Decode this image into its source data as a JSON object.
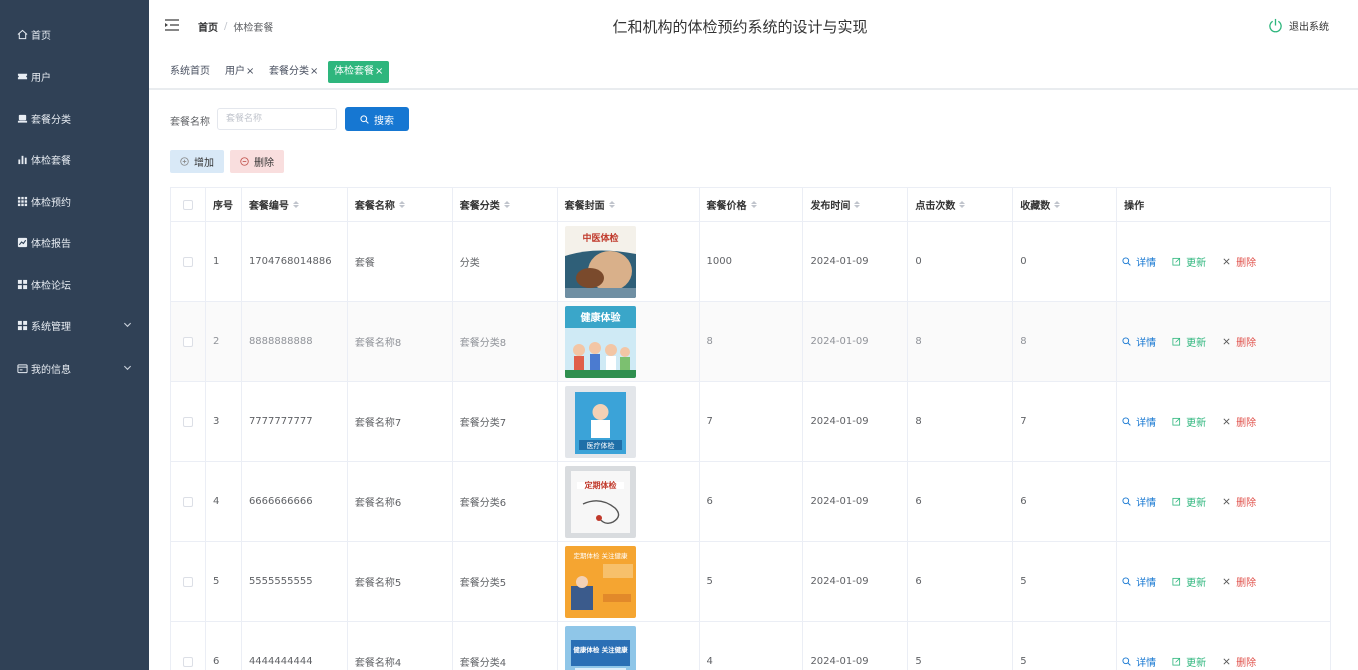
{
  "app": {
    "title": "仁和机构的体检预约系统的设计与实现",
    "logout_label": "退出系统"
  },
  "sidebar": {
    "items": [
      {
        "label": "首页",
        "icon": "home-icon"
      },
      {
        "label": "用户",
        "icon": "ticket-icon"
      },
      {
        "label": "套餐分类",
        "icon": "tray-icon"
      },
      {
        "label": "体检套餐",
        "icon": "bar-chart-icon"
      },
      {
        "label": "体检预约",
        "icon": "grid-icon"
      },
      {
        "label": "体检报告",
        "icon": "chart-card-icon"
      },
      {
        "label": "体检论坛",
        "icon": "apps-icon"
      },
      {
        "label": "系统管理",
        "icon": "apps-icon",
        "has_submenu": true
      },
      {
        "label": "我的信息",
        "icon": "window-icon",
        "has_submenu": true
      }
    ]
  },
  "breadcrumb": {
    "home": "首页",
    "separator": "/",
    "current": "体检套餐"
  },
  "tags": [
    {
      "label": "系统首页",
      "closable": false
    },
    {
      "label": "用户",
      "closable": true
    },
    {
      "label": "套餐分类",
      "closable": true
    },
    {
      "label": "体检套餐",
      "closable": true,
      "active": true
    }
  ],
  "tag_close": "×",
  "search": {
    "label": "套餐名称",
    "placeholder": "套餐名称",
    "value": "",
    "button": "搜索"
  },
  "actions": {
    "add": "增加",
    "delete": "删除"
  },
  "table": {
    "columns": [
      "序号",
      "套餐编号",
      "套餐名称",
      "套餐分类",
      "套餐封面",
      "套餐价格",
      "发布时间",
      "点击次数",
      "收藏数",
      "操作"
    ],
    "ops": {
      "detail": "详情",
      "update": "更新",
      "delete": "删除"
    },
    "rows": [
      {
        "no": "1",
        "code": "1704768014886",
        "name": "套餐",
        "category": "分类",
        "cover": "中医体检",
        "price": "1000",
        "time": "2024-01-09",
        "clicks": "0",
        "fav": "0"
      },
      {
        "no": "2",
        "code": "8888888888",
        "name": "套餐名称8",
        "category": "套餐分类8",
        "cover": "健康体验",
        "price": "8",
        "time": "2024-01-09",
        "clicks": "8",
        "fav": "8"
      },
      {
        "no": "3",
        "code": "7777777777",
        "name": "套餐名称7",
        "category": "套餐分类7",
        "cover": "医疗体检",
        "price": "7",
        "time": "2024-01-09",
        "clicks": "8",
        "fav": "7"
      },
      {
        "no": "4",
        "code": "6666666666",
        "name": "套餐名称6",
        "category": "套餐分类6",
        "cover": "定期体检",
        "price": "6",
        "time": "2024-01-09",
        "clicks": "6",
        "fav": "6"
      },
      {
        "no": "5",
        "code": "5555555555",
        "name": "套餐名称5",
        "category": "套餐分类5",
        "cover": "定期体检 关注健康",
        "price": "5",
        "time": "2024-01-09",
        "clicks": "6",
        "fav": "5"
      },
      {
        "no": "6",
        "code": "4444444444",
        "name": "套餐名称4",
        "category": "套餐分类4",
        "cover": "健康体检 关注健康",
        "price": "4",
        "time": "2024-01-09",
        "clicks": "5",
        "fav": "5"
      }
    ]
  },
  "colors": {
    "sidebar_bg": "#304156",
    "primary": "#1677d2",
    "success": "#2eb67d",
    "danger": "#e0504a"
  }
}
